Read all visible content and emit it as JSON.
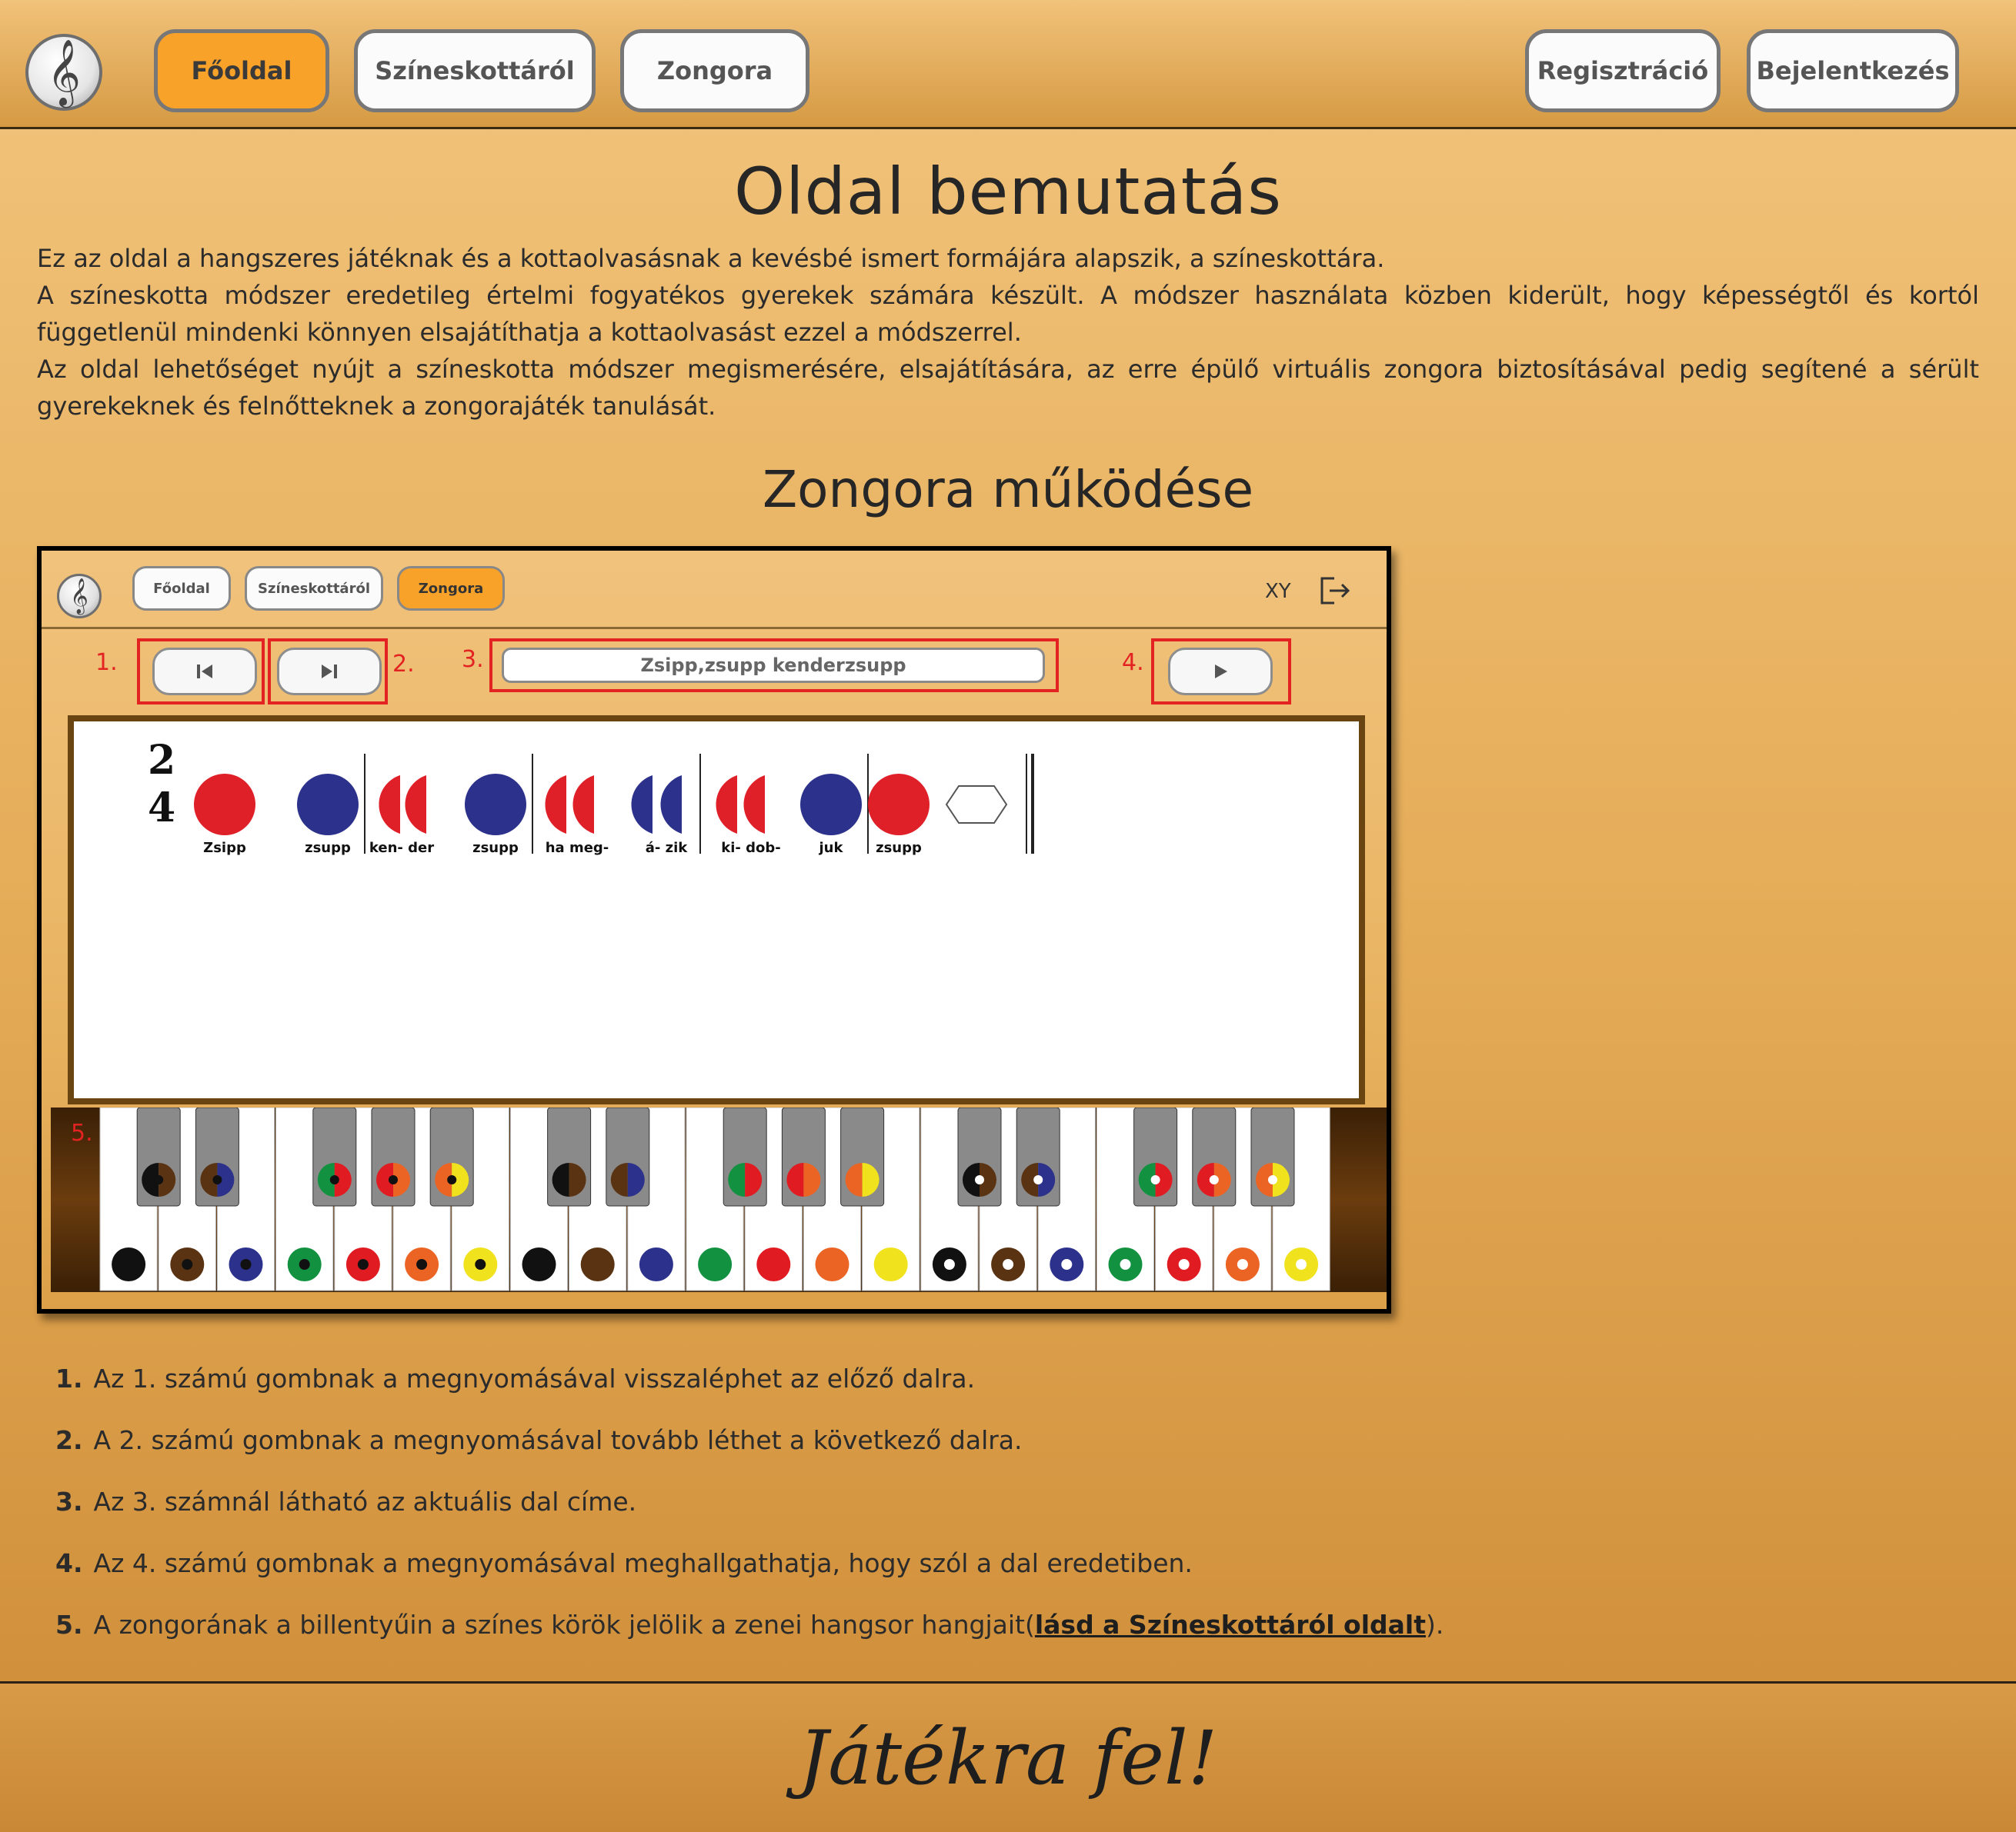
{
  "nav": {
    "logo_icon": "treble-clef-icon",
    "home": "Főoldal",
    "about": "Színeskottáról",
    "piano": "Zongora",
    "register": "Regisztráció",
    "login": "Bejelentkezés",
    "accent_color": "#f9a229"
  },
  "intro": {
    "title": "Oldal bemutatás",
    "p1": "Ez az oldal a hangszeres játéknak és a kottaolvasásnak a kevésbé ismert formájára alapszik, a színeskottára.",
    "p2": "A színeskotta módszer eredetileg értelmi fogyatékos gyerekek számára készült. A módszer használata közben kiderült, hogy képességtől és kortól függetlenül mindenki könnyen elsajátíthatja a kottaolvasást ezzel a módszerrel.",
    "p3": "Az oldal lehetőséget nyújt a színeskotta módszer megismerésére, elsajátítására, az erre épülő virtuális zongora biztosításával pedig segítené a sérült gyerekeknek és felnőtteknek a zongorajáték tanulását."
  },
  "piano_section": {
    "title": "Zongora működése",
    "screenshot": {
      "nav_home": "Főoldal",
      "nav_about": "Színeskottáról",
      "nav_piano": "Zongora",
      "user": "XY",
      "logout_icon": "logout-icon",
      "labels": [
        "1.",
        "2.",
        "3.",
        "4.",
        "5."
      ],
      "prev_icon": "skip-previous-icon",
      "next_icon": "skip-next-icon",
      "play_icon": "play-icon",
      "song_title": "Zsipp,zsupp kenderzsupp",
      "time_signature_top": "2",
      "time_signature_bottom": "4",
      "lyrics": [
        "Zsipp",
        "zsupp",
        "ken- der",
        "zsupp",
        "ha meg-",
        "á- zik",
        "ki- dob-",
        "juk",
        "zsupp"
      ]
    }
  },
  "instructions": [
    {
      "num": "1.",
      "text": "Az 1. számú gombnak a megnyomásával visszaléphet az előző dalra."
    },
    {
      "num": "2.",
      "text": "A 2. számú gombnak a megnyomásával tovább léthet a következő dalra."
    },
    {
      "num": "3.",
      "text": "Az 3. számnál látható az aktuális dal címe."
    },
    {
      "num": "4.",
      "text": "Az 4. számú gombnak a megnyomásával meghallgathatja, hogy szól a dal eredetiben."
    },
    {
      "num": "5.",
      "text": "A zongorának a billentyűin a színes körök jelölik a zenei hangsor hangjait(",
      "link": "lásd a Színeskottáról oldalt",
      "after": ")."
    }
  ],
  "footer": {
    "text": "Játékra fel!"
  }
}
